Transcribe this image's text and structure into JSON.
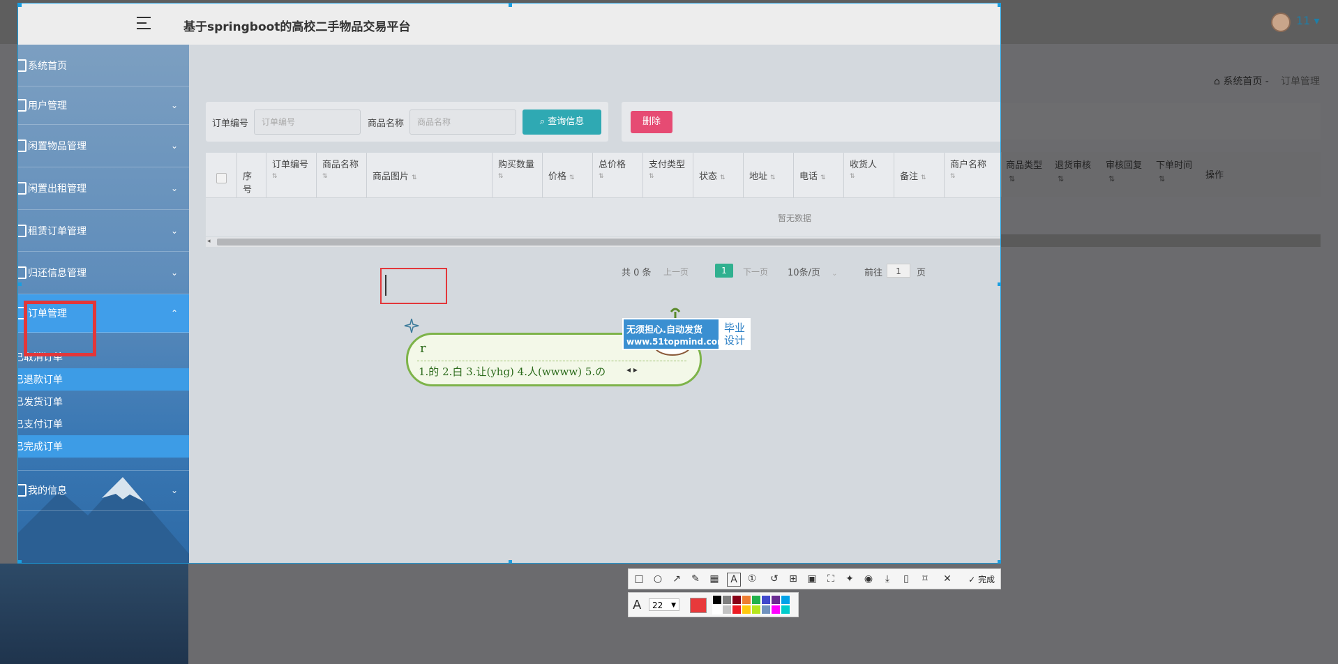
{
  "app": {
    "title": "基于springboot的高校二手物品交易平台",
    "user": "11 ▾"
  },
  "breadcrumb": {
    "home": "系统首页",
    "separator": "-",
    "current": "订单管理"
  },
  "sidebar": {
    "items": [
      {
        "label": "系统首页"
      },
      {
        "label": "用户管理",
        "chevron": "⌄"
      },
      {
        "label": "闲置物品管理",
        "chevron": "⌄"
      },
      {
        "label": "闲置出租管理",
        "chevron": "⌄"
      },
      {
        "label": "租赁订单管理",
        "chevron": "⌄"
      },
      {
        "label": "归还信息管理",
        "chevron": "⌄"
      },
      {
        "label": "订单管理",
        "chevron": "⌃"
      },
      {
        "label": "我的信息",
        "chevron": "⌄"
      }
    ],
    "subitems": [
      {
        "label": "已取消订单"
      },
      {
        "label": "已退款订单"
      },
      {
        "label": "已发货订单"
      },
      {
        "label": "已支付订单"
      },
      {
        "label": "已完成订单"
      }
    ]
  },
  "search": {
    "order_no_label": "订单编号",
    "order_no_placeholder": "订单编号",
    "goods_label": "商品名称",
    "goods_placeholder": "商品名称",
    "query_button": "查询信息",
    "delete_button": "删除"
  },
  "table": {
    "columns": [
      "序号",
      "订单编号",
      "商品名称",
      "商品图片",
      "购买数量",
      "价格",
      "总价格",
      "支付类型",
      "状态",
      "地址",
      "电话",
      "收货人",
      "备注",
      "商户名称",
      "商品类型",
      "退货审核",
      "审核回复",
      "下单时间",
      "操作"
    ],
    "empty_text": "暂无数据"
  },
  "pagination": {
    "total": "共 0 条",
    "prev": "上一页",
    "current": "1",
    "next": "下一页",
    "page_size": "10条/页",
    "goto_label": "前往",
    "goto_value": "1",
    "goto_suffix": "页"
  },
  "ime": {
    "input": "r",
    "candidates": "1.的  2.白  3.让(yhg)  4.人(wwww)  5.の"
  },
  "ad": {
    "main": "无须担心.自动发货",
    "url": "www.51topmind.com",
    "side": "毕业 设计"
  },
  "toolbar": {
    "done_label": "完成",
    "font_size": "22",
    "active_color": "#e8393b",
    "palette": [
      "#000000",
      "#7f7f7f",
      "#880015",
      "#ed7d31",
      "#22b14c",
      "#3f48cc",
      "#6a2c91",
      "#00a2e8",
      "#ffffff",
      "#c3c3c3",
      "#ed1c24",
      "#ffc90e",
      "#b5e61d",
      "#7092be",
      "#ff00ff",
      "#00cccc"
    ]
  }
}
